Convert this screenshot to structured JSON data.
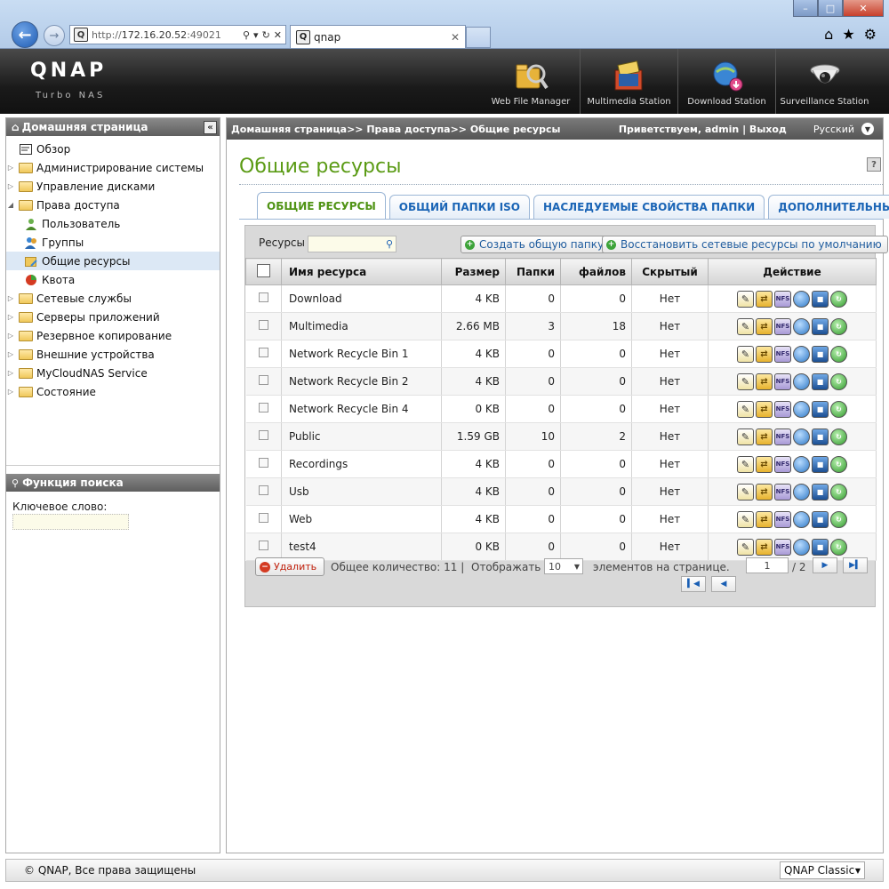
{
  "browser": {
    "url_prefix": "http://",
    "url_host": "172.16.20.52",
    "url_port": ":49021",
    "tab_title": "qnap",
    "window_controls": [
      "minimize-icon",
      "maximize-icon",
      "close-icon"
    ],
    "toolbar_icons": [
      "home-icon",
      "star-icon",
      "gear-icon"
    ]
  },
  "header": {
    "logo": "QNAP",
    "subtitle": "Turbo NAS",
    "apps": [
      {
        "label": "Web File Manager",
        "icon": "web-file-manager-icon"
      },
      {
        "label": "Multimedia Station",
        "icon": "multimedia-station-icon"
      },
      {
        "label": "Download Station",
        "icon": "download-station-icon"
      },
      {
        "label": "Surveillance Station",
        "icon": "surveillance-station-icon"
      }
    ]
  },
  "sidebar": {
    "title": "Домашняя страница",
    "items": [
      {
        "label": "Обзор",
        "level": 0,
        "icon": "overview-icon"
      },
      {
        "label": "Администрирование системы",
        "level": 0,
        "icon": "folder-icon"
      },
      {
        "label": "Управление дисками",
        "level": 0,
        "icon": "folder-icon"
      },
      {
        "label": "Права доступа",
        "level": 0,
        "icon": "folder-open-icon"
      },
      {
        "label": "Пользователь",
        "level": 1,
        "icon": "user-icon"
      },
      {
        "label": "Группы",
        "level": 1,
        "icon": "group-icon"
      },
      {
        "label": "Общие ресурсы",
        "level": 1,
        "icon": "share-folder-icon"
      },
      {
        "label": "Квота",
        "level": 1,
        "icon": "quota-icon"
      },
      {
        "label": "Сетевые службы",
        "level": 0,
        "icon": "folder-icon"
      },
      {
        "label": "Серверы приложений",
        "level": 0,
        "icon": "folder-icon"
      },
      {
        "label": "Резервное копирование",
        "level": 0,
        "icon": "folder-icon"
      },
      {
        "label": "Внешние устройства",
        "level": 0,
        "icon": "folder-icon"
      },
      {
        "label": "MyCloudNAS Service",
        "level": 0,
        "icon": "folder-icon"
      },
      {
        "label": "Состояние",
        "level": 0,
        "icon": "folder-icon"
      }
    ],
    "search": {
      "title": "Функция поиска",
      "keyword_label": "Ключевое слово:",
      "keyword_value": ""
    }
  },
  "main": {
    "breadcrumb": "Домашняя страница>> Права доступа>> Общие ресурсы",
    "welcome": "Приветствуем,  admin | Выход",
    "language": "Русский",
    "title": "Общие ресурсы",
    "tabs": [
      {
        "label": "ОБЩИЕ РЕСУРСЫ",
        "active": true
      },
      {
        "label": "ОБЩИЙ ПАПКИ ISO",
        "active": false
      },
      {
        "label": "НАСЛЕДУЕМЫЕ СВОЙСТВА ПАПКИ",
        "active": false
      },
      {
        "label": "ДОПОЛНИТЕЛЬНЫЕ НАСТ",
        "active": false
      }
    ],
    "resources_label": "Ресурсы",
    "resources_search_value": "",
    "create_btn": "Создать общую папку",
    "restore_btn": "Восстановить сетевые ресурсы по умолчанию",
    "columns": [
      "Имя ресурса",
      "Размер",
      "Папки",
      "файлов",
      "Скрытый",
      "Действие"
    ],
    "rows": [
      {
        "name": "Download",
        "size": "4 KB",
        "folders": "0",
        "files": "0",
        "hidden": "Нет"
      },
      {
        "name": "Multimedia",
        "size": "2.66 MB",
        "folders": "3",
        "files": "18",
        "hidden": "Нет"
      },
      {
        "name": "Network Recycle Bin 1",
        "size": "4 KB",
        "folders": "0",
        "files": "0",
        "hidden": "Нет"
      },
      {
        "name": "Network Recycle Bin 2",
        "size": "4 KB",
        "folders": "0",
        "files": "0",
        "hidden": "Нет"
      },
      {
        "name": "Network Recycle Bin 4",
        "size": "0 KB",
        "folders": "0",
        "files": "0",
        "hidden": "Нет"
      },
      {
        "name": "Public",
        "size": "1.59 GB",
        "folders": "10",
        "files": "2",
        "hidden": "Нет"
      },
      {
        "name": "Recordings",
        "size": "4 KB",
        "folders": "0",
        "files": "0",
        "hidden": "Нет"
      },
      {
        "name": "Usb",
        "size": "4 KB",
        "folders": "0",
        "files": "0",
        "hidden": "Нет"
      },
      {
        "name": "Web",
        "size": "4 KB",
        "folders": "0",
        "files": "0",
        "hidden": "Нет"
      },
      {
        "name": "test4",
        "size": "0 KB",
        "folders": "0",
        "files": "0",
        "hidden": "Нет"
      }
    ],
    "action_icons": [
      "edit-icon",
      "permissions-icon",
      "nfs-icon",
      "web-icon",
      "monitor-icon",
      "refresh-icon"
    ],
    "nfs_label": "NFS",
    "pager": {
      "delete_btn": "Удалить",
      "total": "Общее количество: 11  |",
      "show_label": "Отображать",
      "per_page_value": "10",
      "per_page_suffix": "элементов на странице.",
      "page_value": "1",
      "page_total": "/ 2"
    }
  },
  "footer": {
    "copyright": "© QNAP, Все права защищены",
    "theme": "QNAP Classic"
  },
  "colors": {
    "title_green": "#5b9b15",
    "tab_blue": "#1b65b6",
    "header_dark": "#1a1a1a"
  }
}
